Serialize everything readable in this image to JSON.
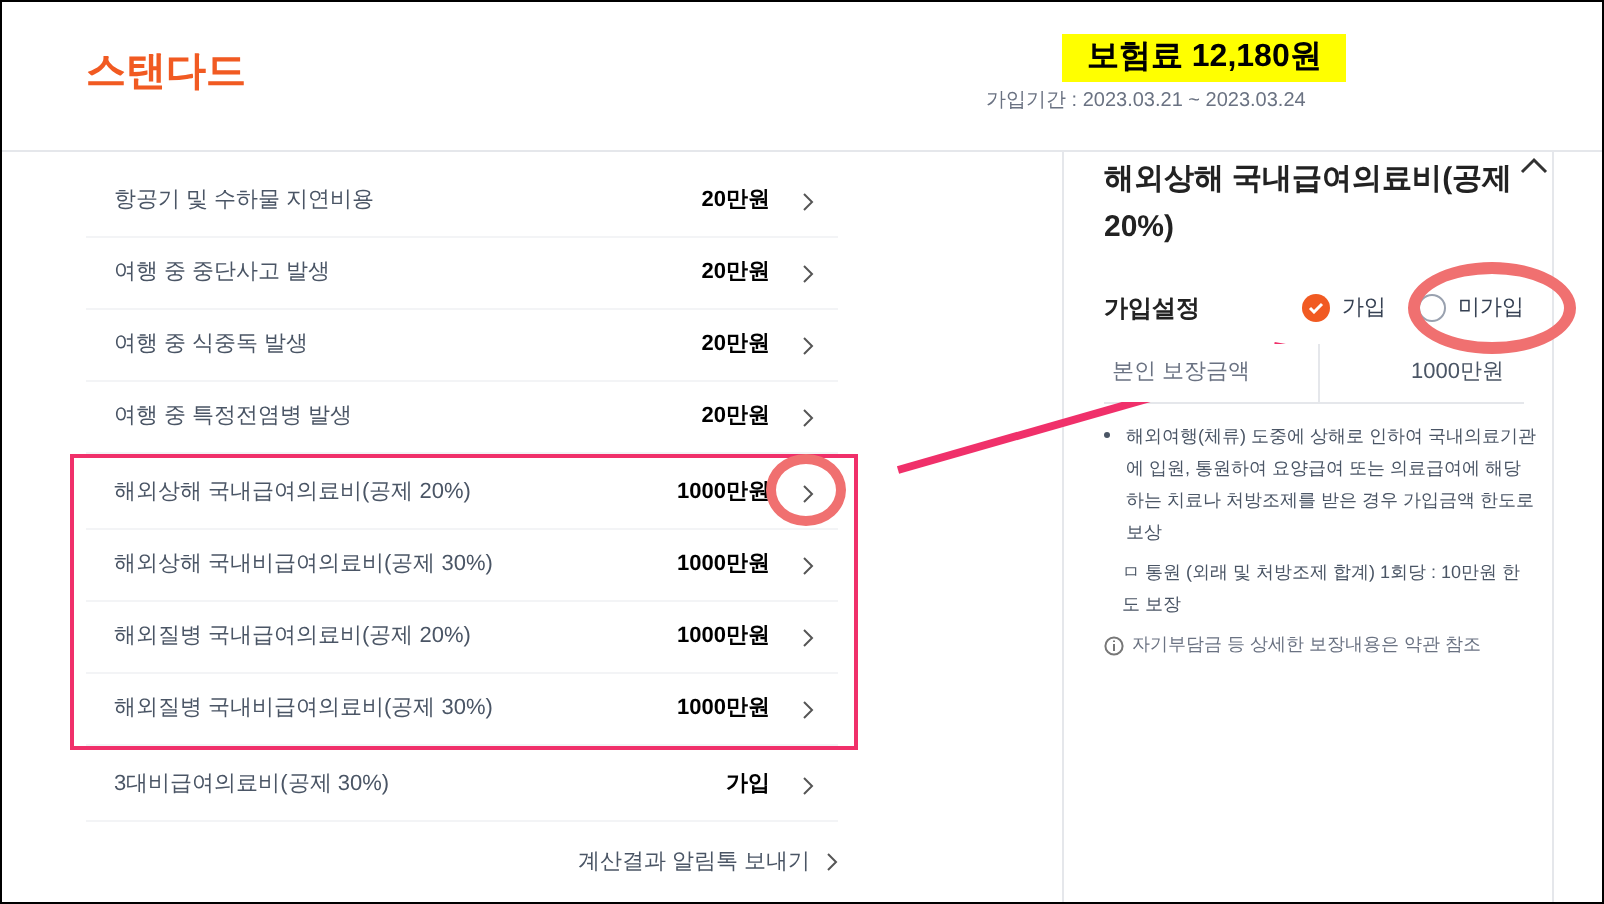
{
  "header": {
    "plan": "스탠다드",
    "premium": "보험료 12,180원",
    "period": "가입기간 : 2023.03.21 ~ 2023.03.24"
  },
  "coverages": [
    {
      "label": "항공기 및 수하물 지연비용",
      "value": "20만원",
      "highlighted": false
    },
    {
      "label": "여행 중 중단사고 발생",
      "value": "20만원",
      "highlighted": false
    },
    {
      "label": "여행 중 식중독 발생",
      "value": "20만원",
      "highlighted": false
    },
    {
      "label": "여행 중 특정전염병 발생",
      "value": "20만원",
      "highlighted": false
    },
    {
      "label": "해외상해 국내급여의료비(공제 20%)",
      "value": "1000만원",
      "highlighted": true
    },
    {
      "label": "해외상해 국내비급여의료비(공제 30%)",
      "value": "1000만원",
      "highlighted": true
    },
    {
      "label": "해외질병 국내급여의료비(공제 20%)",
      "value": "1000만원",
      "highlighted": true
    },
    {
      "label": "해외질병 국내비급여의료비(공제 30%)",
      "value": "1000만원",
      "highlighted": true
    },
    {
      "label": "3대비급여의료비(공제 30%)",
      "value": "가입",
      "highlighted": false
    }
  ],
  "send_link": "계산결과 알림톡 보내기",
  "detail": {
    "title": "해외상해 국내급여의료비(공제 20%)",
    "setting_label": "가입설정",
    "options": [
      {
        "label": "가입",
        "selected": true
      },
      {
        "label": "미가입",
        "selected": false
      }
    ],
    "amount_label": "본인 보장금액",
    "amount": "1000만원",
    "description": "해외여행(체류) 도중에 상해로 인하여 국내의료기관에 입원, 통원하여 요양급여 또는 의료급여에 해당하는 치료나 처방조제를 받은 경우 가입금액 한도로 보상",
    "note": "ㅁ 통원 (외래 및 처방조제 합계) 1회당 : 10만원 한도 보장",
    "info": "자기부담금 등 상세한 보장내용은 약관 참조"
  }
}
